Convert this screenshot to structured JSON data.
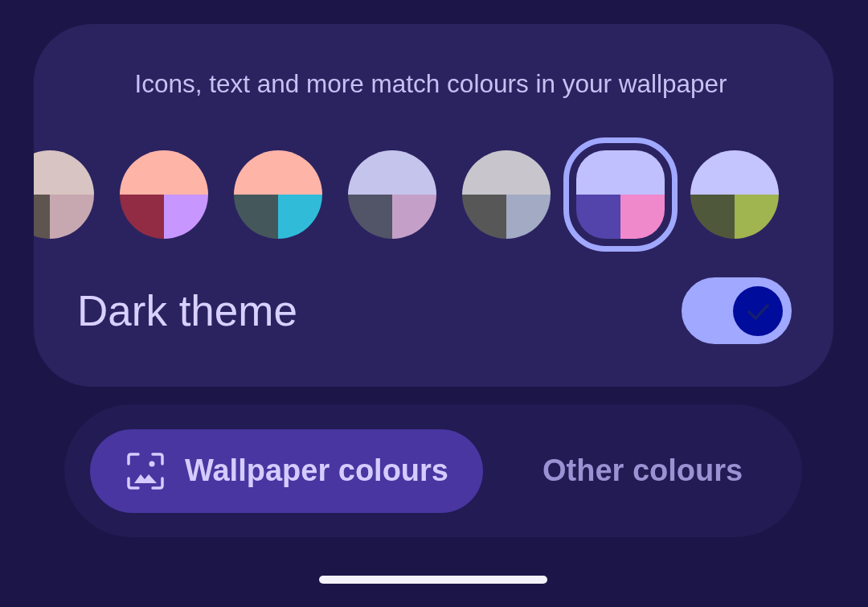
{
  "subtitle": "Icons, text and more match colours in your wallpaper",
  "swatches": [
    {
      "selected": false,
      "parts": [
        {
          "color": "#d8c4c2"
        },
        {
          "color": "#5e5450"
        },
        {
          "color": "#c8a8b0"
        }
      ]
    },
    {
      "selected": false,
      "parts": [
        {
          "color": "#ffb4a8"
        },
        {
          "color": "#922c44"
        },
        {
          "color": "#c896ff"
        }
      ]
    },
    {
      "selected": false,
      "parts": [
        {
          "color": "#ffb4a8"
        },
        {
          "color": "#44585c"
        },
        {
          "color": "#30bcd8"
        }
      ]
    },
    {
      "selected": false,
      "parts": [
        {
          "color": "#c4c4ec"
        },
        {
          "color": "#525468"
        },
        {
          "color": "#c4a0c8"
        }
      ]
    },
    {
      "selected": false,
      "parts": [
        {
          "color": "#c8c6cc"
        },
        {
          "color": "#575757"
        },
        {
          "color": "#a2aac4"
        }
      ]
    },
    {
      "selected": true,
      "parts": [
        {
          "color": "#c0c0ff"
        },
        {
          "color": "#5244aa"
        },
        {
          "color": "#f088cc"
        }
      ]
    },
    {
      "selected": false,
      "parts": [
        {
          "color": "#c4c4ff"
        },
        {
          "color": "#50583c"
        },
        {
          "color": "#a0b450"
        }
      ]
    }
  ],
  "dark_theme": {
    "label": "Dark theme",
    "on": true
  },
  "segments": [
    {
      "label": "Wallpaper colours",
      "selected": true
    },
    {
      "label": "Other colours",
      "selected": false
    }
  ]
}
